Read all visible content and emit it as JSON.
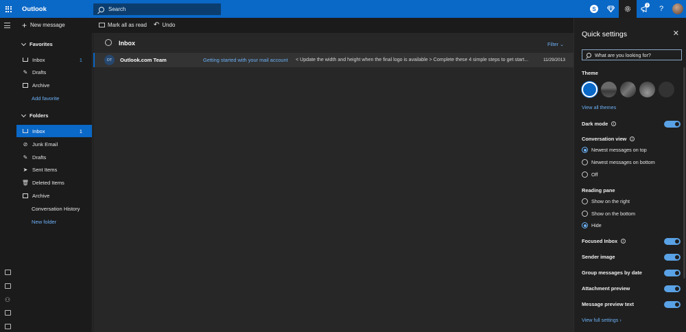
{
  "topbar": {
    "app_name": "Outlook",
    "search_placeholder": "Search",
    "notification_count": "1",
    "skype_letter": "S",
    "help_glyph": "?",
    "accent": "#0a68c7"
  },
  "commands": {
    "new_message": "New message",
    "mark_all_read": "Mark all as read",
    "undo": "Undo"
  },
  "favorites": {
    "header": "Favorites",
    "items": [
      {
        "label": "Inbox",
        "icon": "inbox-icon",
        "count": "1"
      },
      {
        "label": "Drafts",
        "icon": "pencil-icon",
        "count": ""
      },
      {
        "label": "Archive",
        "icon": "archive-icon",
        "count": ""
      }
    ],
    "add_favorite": "Add favorite"
  },
  "folders": {
    "header": "Folders",
    "items": [
      {
        "label": "Inbox",
        "icon": "inbox-icon",
        "count": "1"
      },
      {
        "label": "Junk Email",
        "icon": "block-icon",
        "count": ""
      },
      {
        "label": "Drafts",
        "icon": "pencil-icon",
        "count": ""
      },
      {
        "label": "Sent Items",
        "icon": "send-icon",
        "count": ""
      },
      {
        "label": "Deleted Items",
        "icon": "trash-icon",
        "count": ""
      },
      {
        "label": "Archive",
        "icon": "archive-icon",
        "count": ""
      },
      {
        "label": "Conversation History",
        "icon": "",
        "count": ""
      }
    ],
    "new_folder": "New folder"
  },
  "message_list": {
    "title": "Inbox",
    "filter": "Filter",
    "messages": [
      {
        "initials": "OT",
        "sender": "Outlook.com Team",
        "subject": "Getting started with your mail account",
        "preview": "< Update the width and height when the final logo is available > Complete these 4 simple steps to get start...",
        "date": "11/29/2013"
      }
    ]
  },
  "quick_settings": {
    "title": "Quick settings",
    "search_placeholder": "What are you looking for?",
    "theme_label": "Theme",
    "view_all_themes": "View all themes",
    "dark_mode": "Dark mode",
    "conversation_view": "Conversation view",
    "conversation_options": [
      "Newest messages on top",
      "Newest messages on bottom",
      "Off"
    ],
    "reading_pane": "Reading pane",
    "reading_pane_options": [
      "Show on the right",
      "Show on the bottom",
      "Hide"
    ],
    "focused_inbox": "Focused Inbox",
    "sender_image": "Sender image",
    "group_by_date": "Group messages by date",
    "attachment_preview": "Attachment preview",
    "message_preview_text": "Message preview text",
    "view_full_settings": "View full settings"
  }
}
